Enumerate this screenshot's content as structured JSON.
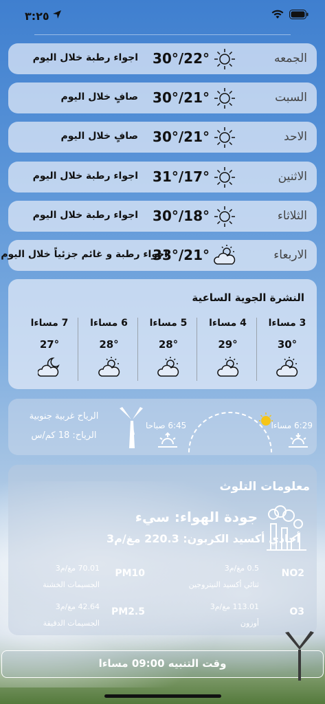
{
  "status_bar": {
    "time": "٣:٢٥"
  },
  "forecast": [
    {
      "day": "الجمعه",
      "temp": "30°/22°",
      "desc": "اجواء رطبة خلال اليوم",
      "icon": "sun-icon"
    },
    {
      "day": "السبت",
      "temp": "30°/21°",
      "desc": "صافٍ خلال اليوم",
      "icon": "sun-icon"
    },
    {
      "day": "الاحد",
      "temp": "30°/21°",
      "desc": "صافٍ خلال اليوم",
      "icon": "sun-icon"
    },
    {
      "day": "الاثنين",
      "temp": "31°/17°",
      "desc": "اجواء رطبة خلال اليوم",
      "icon": "sun-icon"
    },
    {
      "day": "الثلاثاء",
      "temp": "30°/18°",
      "desc": "اجواء رطبة خلال اليوم",
      "icon": "sun-icon"
    },
    {
      "day": "الاربعاء",
      "temp": "33°/21°",
      "desc": "اجواء رطبة و غائم جزئياً خلال اليوم",
      "icon": "partly-cloudy-icon"
    }
  ],
  "hourly": {
    "title": "النشرة الجوية الساعية",
    "hours": [
      {
        "label": "3 مساءا",
        "temp": "30°",
        "icon": "partly-cloudy-icon"
      },
      {
        "label": "4 مساءا",
        "temp": "29°",
        "icon": "partly-cloudy-icon"
      },
      {
        "label": "5 مساءا",
        "temp": "28°",
        "icon": "partly-cloudy-icon"
      },
      {
        "label": "6 مساءا",
        "temp": "28°",
        "icon": "partly-cloudy-icon"
      },
      {
        "label": "7 مساءا",
        "temp": "27°",
        "icon": "moon-cloud-icon"
      }
    ]
  },
  "sun_wind": {
    "sunset_time": "6:29 مساءا",
    "sunrise_time": "6:45 صباحا",
    "wind_direction": "الرياح غربية جنوبية",
    "wind_speed": "الرياح: 18 كم/س"
  },
  "pollution": {
    "title": "معلومات التلوث",
    "air_quality": "جودة الهواء: سيء",
    "co": "أحادي أكسيد الكربون: 220.3 مغ/م3",
    "items": [
      {
        "code": "NO2",
        "value": "0.5 مغ/م3",
        "name": "ثنائي أكسيد النيتروجين"
      },
      {
        "code": "PM10",
        "value": "70.01 مغ/م3",
        "name": "الجسيمات الخشنة"
      },
      {
        "code": "O3",
        "value": "113.01 مغ/م3",
        "name": "أوزون"
      },
      {
        "code": "PM2.5",
        "value": "42.64 مغ/م3",
        "name": "الجسيمات الدقيقة"
      }
    ]
  },
  "alarm": {
    "label": "وقت التنبيه 09:00 مساءا"
  },
  "colors": {
    "sun": "#f5c518",
    "card": "#e4ecf8"
  }
}
